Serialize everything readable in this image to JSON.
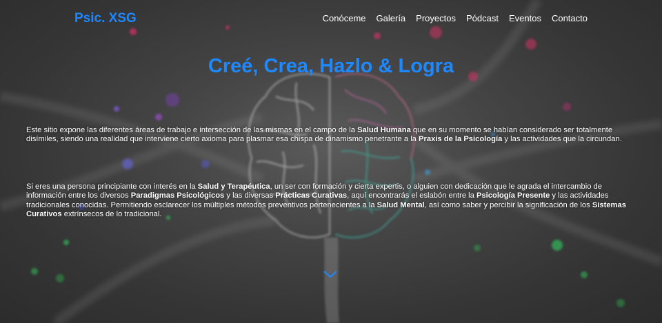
{
  "header": {
    "brand": "Psic. XSG",
    "nav": [
      "Conóceme",
      "Galería",
      "Proyectos",
      "Pódcast",
      "Eventos",
      "Contacto"
    ]
  },
  "hero": {
    "title": "Creé, Crea, Hazlo & Logra",
    "p1": [
      "Este sitio expone las diferentes áreas de trabajo e intersección de las mismas en el campo de la ",
      "Salud Humana",
      " que en su momento se habían considerado ser totalmente disímiles, siendo una realidad que interviene cierto axioma para plasmar esa chispa de dinamismo penetrante a la ",
      "Praxis de la Psicología",
      " y las actividades que la circundan."
    ],
    "p2": [
      "Si eres una persona principiante con interés en la ",
      "Salud y Terapéutica",
      ", un ser con formación y cierta expertis, o alguien con dedicación que le agrada el intercambio de información entre los diversos ",
      "Paradigmas Psicológicos",
      " y las diversas ",
      "Prácticas Curativas",
      ", aquí encontrarás el eslabón entre la ",
      "Psicología Presente",
      " y las actividades tradicionales conocidas. Permitiendo esclarecer los múltiples métodos preventivos pertenecientes a la ",
      "Salud Mental",
      ", así como saber y percibir la significación de los ",
      "Sistemas Curativos",
      " extrínsecos de lo tradicional."
    ]
  },
  "icons": {
    "scroll": "chevron-down-icon"
  },
  "colors": {
    "accent": "#1e88ff",
    "text": "#ffffff",
    "background": "#3a3a3a"
  }
}
